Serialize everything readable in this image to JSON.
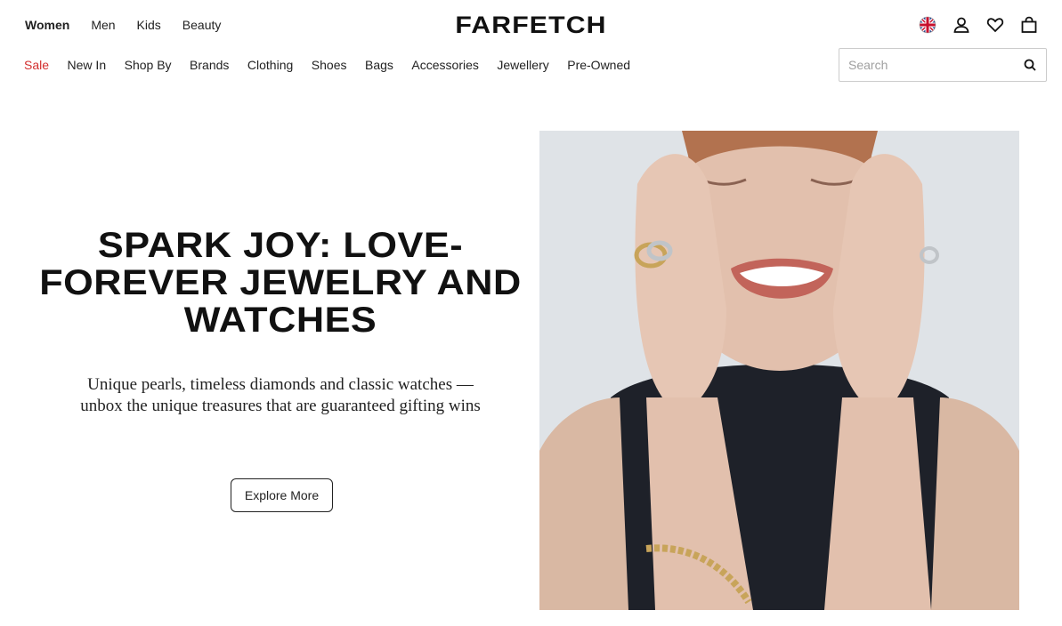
{
  "header": {
    "gender_nav": [
      {
        "label": "Women",
        "active": true
      },
      {
        "label": "Men",
        "active": false
      },
      {
        "label": "Kids",
        "active": false
      },
      {
        "label": "Beauty",
        "active": false
      }
    ],
    "logo": "FARFETCH",
    "icons": [
      "uk-flag-icon",
      "account-icon",
      "wishlist-heart-icon",
      "shopping-bag-icon"
    ]
  },
  "category_nav": [
    {
      "label": "Sale",
      "highlight": true
    },
    {
      "label": "New In"
    },
    {
      "label": "Shop By"
    },
    {
      "label": "Brands"
    },
    {
      "label": "Clothing"
    },
    {
      "label": "Shoes"
    },
    {
      "label": "Bags"
    },
    {
      "label": "Accessories"
    },
    {
      "label": "Jewellery"
    },
    {
      "label": "Pre-Owned"
    }
  ],
  "search": {
    "placeholder": "Search",
    "value": "",
    "icon": "search-icon"
  },
  "hero": {
    "title": "SPARK JOY: LOVE-FOREVER JEWELRY AND WATCHES",
    "subtitle": "Unique pearls, timeless diamonds and classic watches — unbox the unique treasures that are guaranteed gifting wins",
    "cta_label": "Explore More",
    "image_alt_semantic": "model-with-rings-and-bracelet-image"
  },
  "colors": {
    "sale": "#d32f2f",
    "text": "#222222",
    "image_bg": "#dfe3e7"
  }
}
